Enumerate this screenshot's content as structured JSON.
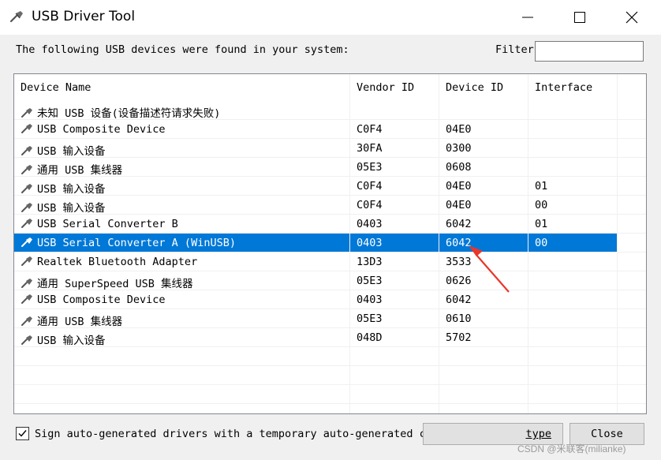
{
  "window": {
    "title": "USB Driver Tool"
  },
  "toolbar": {
    "prompt": "The following USB devices were found in your system:",
    "filter_label": "Filter",
    "filter_value": ""
  },
  "table": {
    "columns": [
      "Device Name",
      "Vendor ID",
      "Device ID",
      "Interface"
    ],
    "rows": [
      {
        "name": "未知 USB 设备(设备描述符请求失败)",
        "vendor": "",
        "device": "",
        "interface": ""
      },
      {
        "name": "USB Composite Device",
        "vendor": "C0F4",
        "device": "04E0",
        "interface": ""
      },
      {
        "name": "USB 输入设备",
        "vendor": "30FA",
        "device": "0300",
        "interface": ""
      },
      {
        "name": "通用 USB 集线器",
        "vendor": "05E3",
        "device": "0608",
        "interface": ""
      },
      {
        "name": "USB 输入设备",
        "vendor": "C0F4",
        "device": "04E0",
        "interface": "01"
      },
      {
        "name": "USB 输入设备",
        "vendor": "C0F4",
        "device": "04E0",
        "interface": "00"
      },
      {
        "name": "USB Serial Converter B",
        "vendor": "0403",
        "device": "6042",
        "interface": "01"
      },
      {
        "name": "USB Serial Converter A (WinUSB)",
        "vendor": "0403",
        "device": "6042",
        "interface": "00",
        "selected": true
      },
      {
        "name": "Realtek Bluetooth Adapter",
        "vendor": "13D3",
        "device": "3533",
        "interface": ""
      },
      {
        "name": "通用 SuperSpeed USB 集线器",
        "vendor": "05E3",
        "device": "0626",
        "interface": ""
      },
      {
        "name": "USB Composite Device",
        "vendor": "0403",
        "device": "6042",
        "interface": ""
      },
      {
        "name": "通用 USB 集线器",
        "vendor": "05E3",
        "device": "0610",
        "interface": ""
      },
      {
        "name": "USB 输入设备",
        "vendor": "048D",
        "device": "5702",
        "interface": ""
      }
    ]
  },
  "footer": {
    "sign_label": "Sign auto-generated drivers with a temporary auto-generated certificate",
    "sign_checked": true,
    "type_button": "type",
    "close_button": "Close",
    "watermark": "CSDN @米联客(milianke)"
  },
  "colors": {
    "selection": "#0078d7",
    "annotation_arrow": "#e8362a"
  },
  "icons": {
    "app": "usb-plug-icon",
    "device": "usb-plug-icon",
    "minimize": "minimize-icon",
    "maximize": "maximize-icon",
    "close": "close-icon"
  }
}
